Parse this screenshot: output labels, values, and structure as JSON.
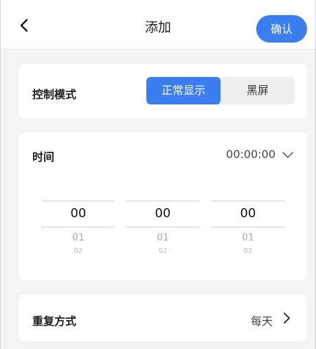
{
  "header": {
    "title": "添加",
    "confirm_label": "确认",
    "back_icon": "chevron-left-icon"
  },
  "control": {
    "label": "控制模式",
    "options": [
      "正常显示",
      "黑屏"
    ],
    "selected": "正常显示"
  },
  "time": {
    "label": "时间",
    "value": "00:00:00",
    "expand_icon": "chevron-down-icon",
    "pickers": [
      {
        "selected": "00",
        "next": "01",
        "next2": "02"
      },
      {
        "selected": "00",
        "next": "01",
        "next2": "02"
      },
      {
        "selected": "00",
        "next": "01",
        "next2": "02"
      }
    ]
  },
  "repeat": {
    "label": "重复方式",
    "value": "每天",
    "icon": "chevron-right-icon"
  },
  "colors": {
    "accent": "#3b7ef0",
    "background": "#f3f3f5",
    "card": "#ffffff"
  }
}
